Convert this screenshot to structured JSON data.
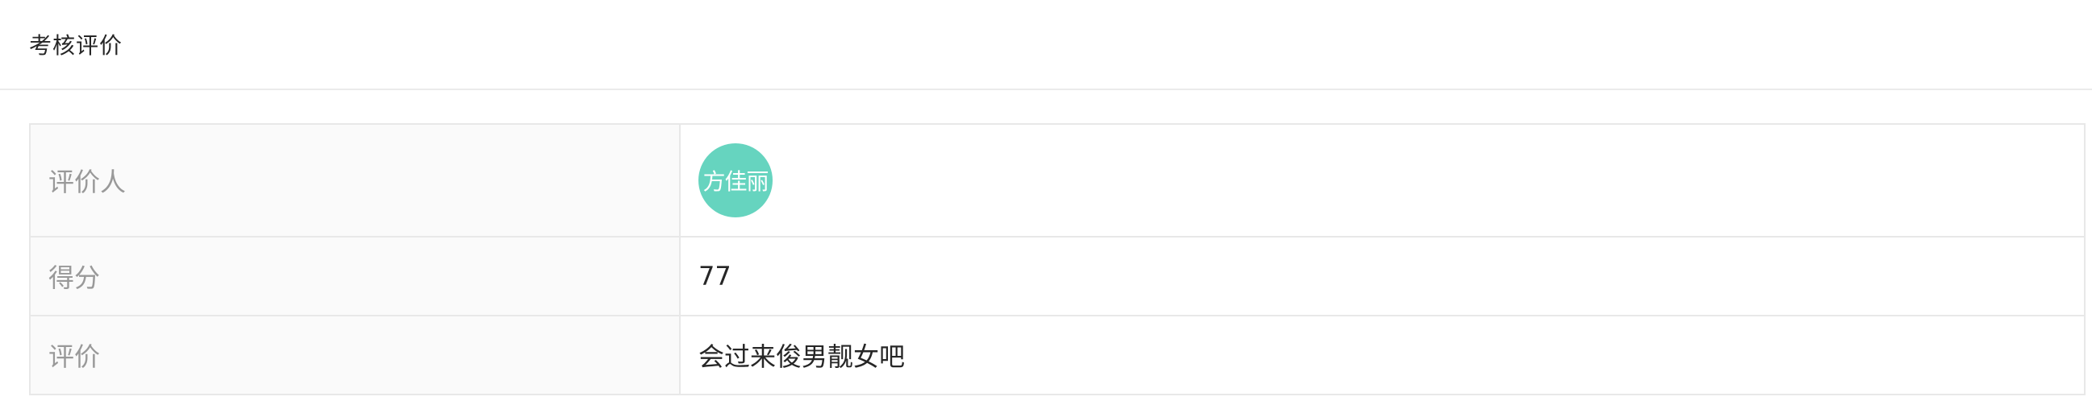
{
  "header": {
    "title": "考核评价"
  },
  "rows": [
    {
      "label": "评价人",
      "avatar_text": "方佳丽",
      "avatar_color": "#66d4bf"
    },
    {
      "label": "得分",
      "value": "77"
    },
    {
      "label": "评价",
      "value": "会过来俊男靓女吧"
    }
  ]
}
